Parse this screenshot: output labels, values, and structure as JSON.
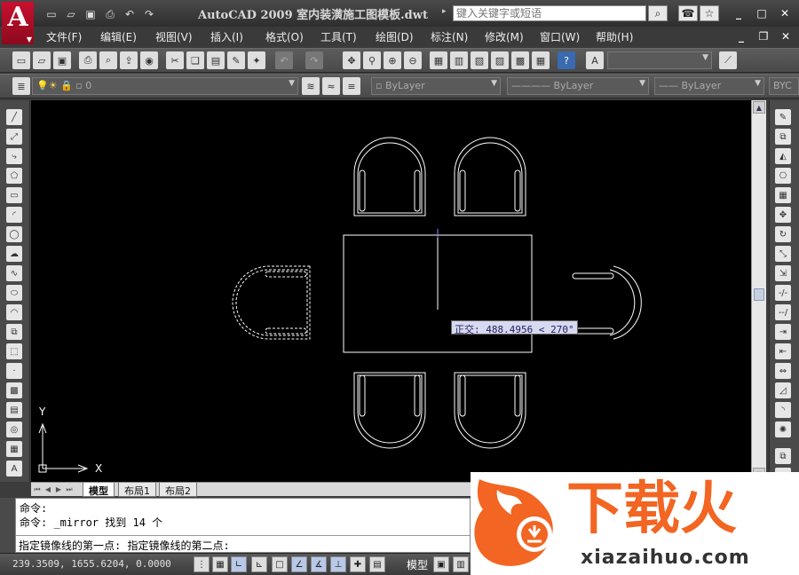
{
  "window": {
    "title": "AutoCAD 2009 室内装潢施工图模板.dwt",
    "search_placeholder": "键入关键字或短语",
    "app_logo_letter": "A"
  },
  "menu": [
    {
      "label": "文件(F)"
    },
    {
      "label": "编辑(E)"
    },
    {
      "label": "视图(V)"
    },
    {
      "label": "插入(I)"
    },
    {
      "label": "格式(O)"
    },
    {
      "label": "工具(T)"
    },
    {
      "label": "绘图(D)"
    },
    {
      "label": "标注(N)"
    },
    {
      "label": "修改(M)"
    },
    {
      "label": "窗口(W)"
    },
    {
      "label": "帮助(H)"
    }
  ],
  "layers_toolbar": {
    "layer_value": "0",
    "color_value": "ByLayer",
    "linetype_value": "ByLayer",
    "lineweight_value": "ByLayer",
    "plotstyle_value": "BYC"
  },
  "canvas": {
    "ortho_tooltip": "正交: 488.4956 < 270°",
    "ucs_x_label": "X",
    "ucs_y_label": "Y"
  },
  "layout_tabs": [
    {
      "label": "模型",
      "active": true
    },
    {
      "label": "布局1",
      "active": false
    },
    {
      "label": "布局2",
      "active": false
    }
  ],
  "command_line": {
    "history": [
      "命令:",
      "命令: _mirror 找到 14 个"
    ],
    "prompt": "指定镜像线的第一点: 指定镜像线的第二点:"
  },
  "status_bar": {
    "coordinates": "239.3509,  1655.6204, 0.0000",
    "model_label": "模型"
  },
  "watermark": {
    "brand_text": "下载火",
    "url_text": "xiazaihuo.com"
  },
  "colors": {
    "canvas_background": "#000000",
    "drawing_lines": "#ffffff",
    "logo_red": "#c8102e",
    "watermark_orange": "#f26522"
  }
}
